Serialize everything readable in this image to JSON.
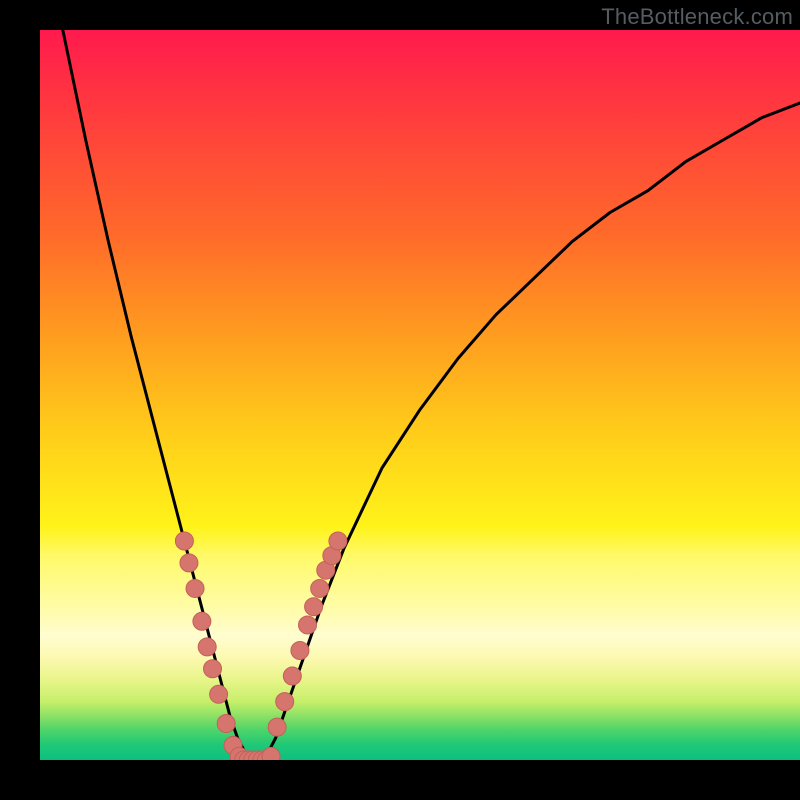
{
  "watermark": "TheBottleneck.com",
  "colors": {
    "frame": "#000000",
    "curve": "#000000",
    "marker_fill": "#d6746e",
    "marker_stroke": "#c46059",
    "gradient_top": "#ff1a4d",
    "gradient_bottom": "#0dbf7f"
  },
  "chart_data": {
    "type": "line",
    "title": "",
    "xlabel": "",
    "ylabel": "",
    "xlim": [
      0,
      100
    ],
    "ylim": [
      0,
      100
    ],
    "grid": false,
    "legend": false,
    "axes_visible": false,
    "note": "The chart has no numeric tick labels; x and y are normalized 0–100. The curve is a V-shaped function reaching 0 near x≈27, rising steeply as x→0 and more gently as x→100. Pink markers are clustered along the lower portion of the V, roughly y∈[0,30].",
    "series": [
      {
        "name": "curve",
        "type": "line",
        "x": [
          0,
          3,
          6,
          9,
          12,
          15,
          17,
          19,
          21,
          23,
          24,
          25,
          26,
          27,
          28,
          29,
          30,
          31,
          32,
          33,
          35,
          37,
          40,
          45,
          50,
          55,
          60,
          65,
          70,
          75,
          80,
          85,
          90,
          95,
          100
        ],
        "y": [
          115,
          100,
          85,
          71,
          58,
          46,
          38,
          30,
          22,
          14,
          10,
          6,
          3,
          1,
          0,
          0,
          1,
          3,
          6,
          9,
          15,
          21,
          29,
          40,
          48,
          55,
          61,
          66,
          71,
          75,
          78,
          82,
          85,
          88,
          90
        ]
      },
      {
        "name": "left-branch-markers",
        "type": "scatter",
        "x": [
          19.0,
          19.6,
          20.4,
          21.3,
          22.0,
          22.7,
          23.5,
          24.5,
          25.4,
          26.2
        ],
        "y": [
          30.0,
          27.0,
          23.5,
          19.0,
          15.5,
          12.5,
          9.0,
          5.0,
          2.0,
          0.5
        ]
      },
      {
        "name": "valley-markers",
        "type": "scatter",
        "x": [
          26.8,
          27.4,
          28.0,
          28.6,
          29.2,
          29.8,
          30.4
        ],
        "y": [
          0.0,
          0.0,
          0.0,
          0.0,
          0.0,
          0.0,
          0.5
        ]
      },
      {
        "name": "right-branch-markers",
        "type": "scatter",
        "x": [
          31.2,
          32.2,
          33.2,
          34.2,
          35.2,
          36.0,
          36.8,
          37.6,
          38.4,
          39.2
        ],
        "y": [
          4.5,
          8.0,
          11.5,
          15.0,
          18.5,
          21.0,
          23.5,
          26.0,
          28.0,
          30.0
        ]
      }
    ]
  }
}
